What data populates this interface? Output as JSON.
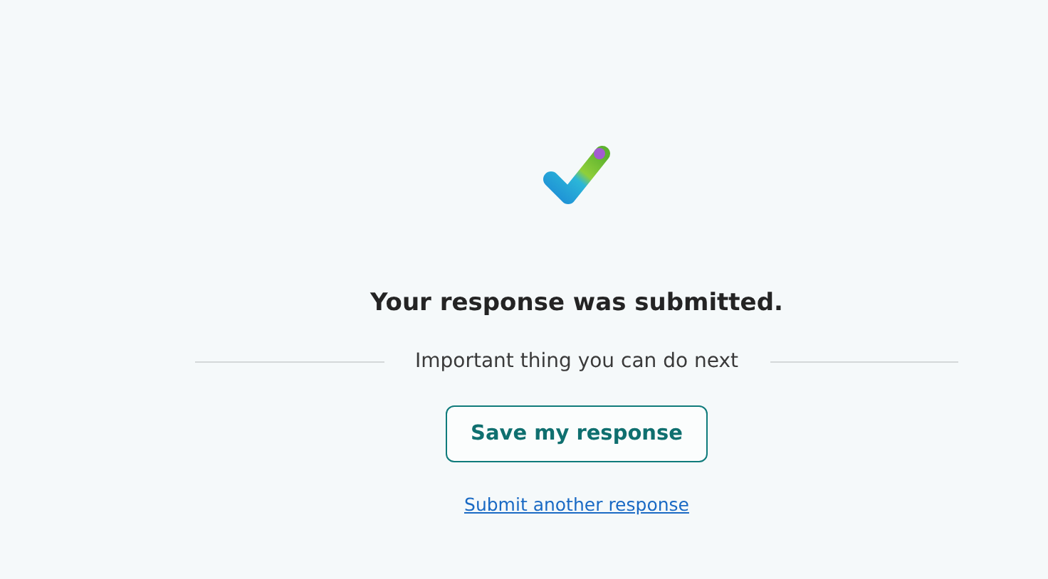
{
  "confirmation": {
    "title": "Your response was submitted.",
    "divider_label": "Important thing you can do next",
    "primary_button": "Save my response",
    "link": "Submit another response"
  }
}
